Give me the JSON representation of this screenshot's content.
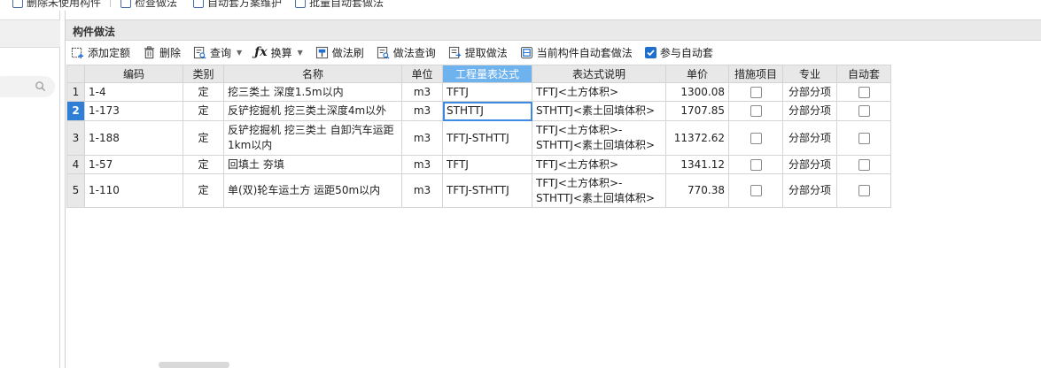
{
  "top_toolbar": {
    "items": [
      {
        "label": "删除未使用构件",
        "icon": "delete-unused-icon"
      },
      {
        "label": "检查做法",
        "icon": "check-method-icon"
      },
      {
        "label": "自动套方案维护",
        "icon": "auto-scheme-icon"
      },
      {
        "label": "批量自动套做法",
        "icon": "batch-auto-icon"
      }
    ]
  },
  "left_panel": {
    "search_icon": "search-icon"
  },
  "panel": {
    "title": "构件做法"
  },
  "toolbar": {
    "add_quota": "添加定额",
    "delete": "删除",
    "query": "查询",
    "convert": "换算",
    "method_brush": "做法刷",
    "method_query": "做法查询",
    "extract_method": "提取做法",
    "current_auto_method": "当前构件自动套做法",
    "join_auto": "参与自动套",
    "join_auto_checked": true
  },
  "table": {
    "headers": [
      "编码",
      "类别",
      "名称",
      "单位",
      "工程量表达式",
      "表达式说明",
      "单价",
      "措施项目",
      "专业",
      "自动套"
    ],
    "highlight_header_index": 4,
    "selected_row": 2,
    "rows": [
      {
        "num": "1",
        "code": "1-4",
        "type": "定",
        "name": "挖三类土 深度1.5m以内",
        "unit": "m3",
        "expr": "TFTJ",
        "desc": "TFTJ<土方体积>",
        "price": "1300.08",
        "measure": false,
        "specialty": "分部分项",
        "auto": false
      },
      {
        "num": "2",
        "code": "1-173",
        "type": "定",
        "name": "反铲挖掘机 挖三类土深度4m以外",
        "unit": "m3",
        "expr": "STHTTJ",
        "desc": "STHTTJ<素土回填体积>",
        "price": "1707.85",
        "measure": false,
        "specialty": "分部分项",
        "auto": false
      },
      {
        "num": "3",
        "code": "1-188",
        "type": "定",
        "name": "反铲挖掘机 挖三类土 自卸汽车运距1km以内",
        "unit": "m3",
        "expr": "TFTJ-STHTTJ",
        "desc": "TFTJ<土方体积>-STHTTJ<素土回填体积>",
        "price": "11372.62",
        "measure": false,
        "specialty": "分部分项",
        "auto": false
      },
      {
        "num": "4",
        "code": "1-57",
        "type": "定",
        "name": "回填土 夯填",
        "unit": "m3",
        "expr": "TFTJ",
        "desc": "TFTJ<土方体积>",
        "price": "1341.12",
        "measure": false,
        "specialty": "分部分项",
        "auto": false
      },
      {
        "num": "5",
        "code": "1-110",
        "type": "定",
        "name": "单(双)轮车运土方 运距50m以内",
        "unit": "m3",
        "expr": "TFTJ-STHTTJ",
        "desc": "TFTJ<土方体积>-STHTTJ<素土回填体积>",
        "price": "770.38",
        "measure": false,
        "specialty": "分部分项",
        "auto": false
      }
    ]
  },
  "colors": {
    "header_highlight": "#6fb3ee",
    "selected_row_number": "#2f7fd6",
    "checkbox_checked": "#1f6fd1"
  }
}
